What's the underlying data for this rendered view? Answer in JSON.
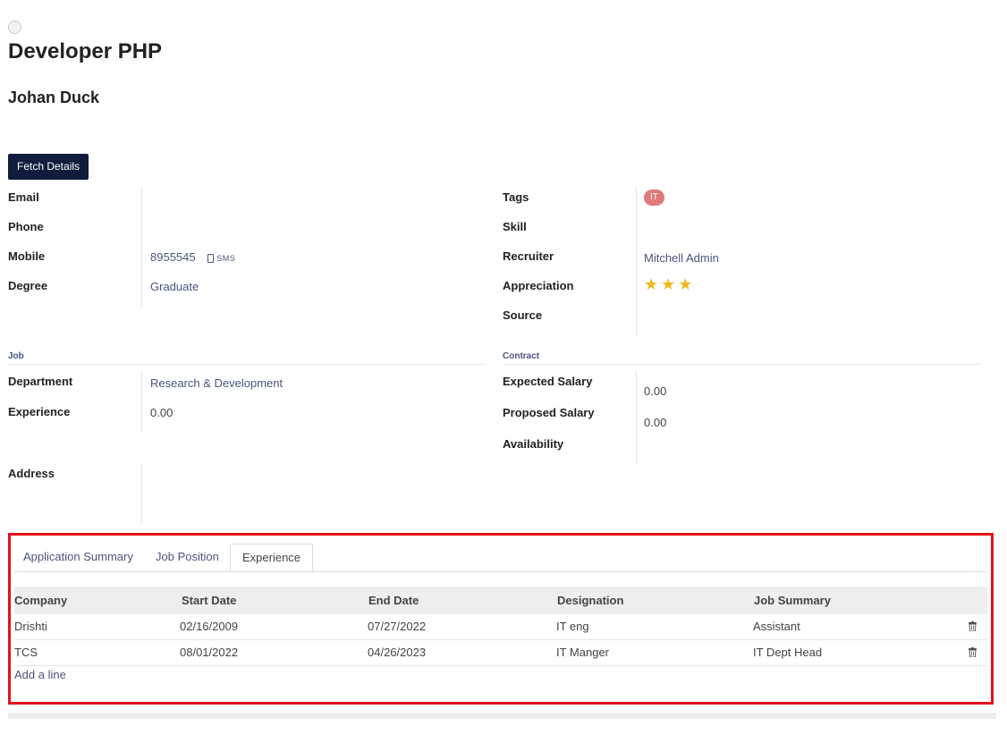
{
  "record": {
    "title": "Developer PHP",
    "applicant_name": "Johan Duck"
  },
  "actions": {
    "fetch_details": "Fetch Details"
  },
  "left_fields": {
    "email_label": "Email",
    "phone_label": "Phone",
    "mobile_label": "Mobile",
    "mobile_value": "8955545",
    "sms_label": "SMS",
    "degree_label": "Degree",
    "degree_value": "Graduate"
  },
  "right_fields": {
    "tags_label": "Tags",
    "tag_value": "IT",
    "skill_label": "Skill",
    "recruiter_label": "Recruiter",
    "recruiter_value": "Mitchell Admin",
    "appreciation_label": "Appreciation",
    "appreciation_stars": 3,
    "appreciation_display": "★★★",
    "source_label": "Source"
  },
  "job": {
    "section_title": "Job",
    "department_label": "Department",
    "department_value": "Research & Development",
    "experience_label": "Experience",
    "experience_value": "0.00"
  },
  "contract": {
    "section_title": "Contract",
    "expected_salary_label": "Expected Salary",
    "expected_salary_value": "0.00",
    "proposed_salary_label": "Proposed Salary",
    "proposed_salary_value": "0.00",
    "availability_label": "Availability"
  },
  "address": {
    "label": "Address"
  },
  "notebook": {
    "tabs": [
      "Application Summary",
      "Job Position",
      "Experience"
    ],
    "active_tab": "Experience",
    "columns": [
      "Company",
      "Start Date",
      "End Date",
      "Designation",
      "Job Summary"
    ],
    "rows": [
      [
        "Drishti",
        "02/16/2009",
        "07/27/2022",
        "IT eng",
        "Assistant"
      ],
      [
        "TCS",
        "08/01/2022",
        "04/26/2023",
        "IT Manger",
        "IT Dept Head"
      ]
    ],
    "add_line": "Add a line"
  },
  "colors": {
    "primary_button": "#111c3d",
    "tag_background": "#e07a7a",
    "star": "#f0b81c",
    "link": "#4a5580",
    "highlight_border": "#e0121b"
  },
  "icons": {
    "status": "circle-icon",
    "sms": "mobile-phone-icon",
    "delete": "trash-icon"
  }
}
